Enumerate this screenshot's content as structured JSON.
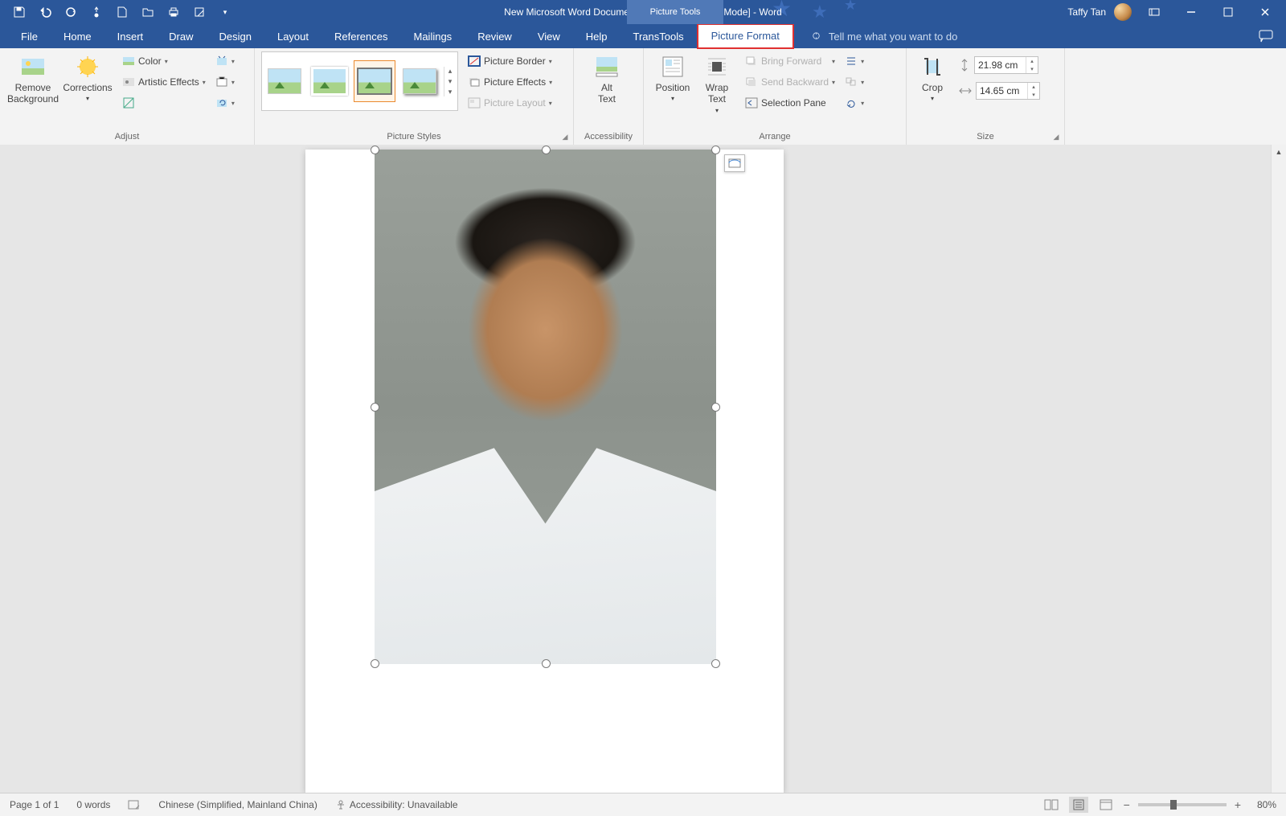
{
  "title": "New Microsoft Word Document.docx [Compatibility Mode]  -  Word",
  "context_tab": "Picture Tools",
  "user": "Taffy Tan",
  "tabs": [
    "File",
    "Home",
    "Insert",
    "Draw",
    "Design",
    "Layout",
    "References",
    "Mailings",
    "Review",
    "View",
    "Help",
    "TransTools",
    "Picture Format"
  ],
  "active_tab": "Picture Format",
  "tellme": "Tell me what you want to do",
  "ribbon": {
    "adjust": {
      "label": "Adjust",
      "remove_bg": "Remove\nBackground",
      "corrections": "Corrections",
      "color": "Color",
      "artistic": "Artistic Effects"
    },
    "styles": {
      "label": "Picture Styles",
      "border": "Picture Border",
      "effects": "Picture Effects",
      "layout": "Picture Layout"
    },
    "access": {
      "label": "Accessibility",
      "alt": "Alt\nText"
    },
    "arrange": {
      "label": "Arrange",
      "position": "Position",
      "wrap": "Wrap\nText",
      "forward": "Bring Forward",
      "backward": "Send Backward",
      "selection": "Selection Pane"
    },
    "size": {
      "label": "Size",
      "crop": "Crop",
      "height": "21.98 cm",
      "width": "14.65 cm"
    }
  },
  "status": {
    "page": "Page 1 of 1",
    "words": "0 words",
    "lang": "Chinese (Simplified, Mainland China)",
    "access": "Accessibility: Unavailable",
    "zoom": "80%"
  }
}
